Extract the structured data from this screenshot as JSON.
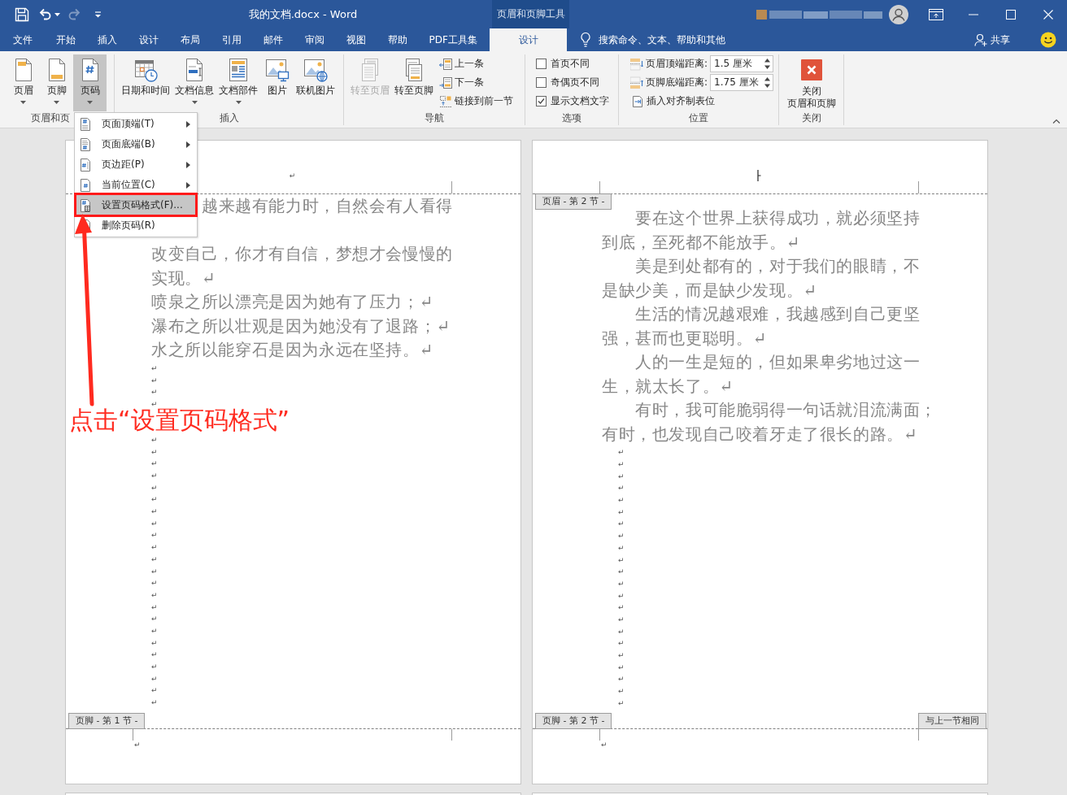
{
  "window": {
    "title": "我的文档.docx - Word",
    "contextual_tab_group": "页眉和页脚工具"
  },
  "quick_access": [
    {
      "kind": "save",
      "disabled": false,
      "dropdown": false
    },
    {
      "kind": "undo",
      "disabled": false,
      "dropdown": true
    },
    {
      "kind": "redo",
      "disabled": true,
      "dropdown": false
    },
    {
      "kind": "customize",
      "disabled": false,
      "dropdown": false
    }
  ],
  "tabs": [
    {
      "label": "文件",
      "selected": false
    },
    {
      "label": "开始",
      "selected": false
    },
    {
      "label": "插入",
      "selected": false
    },
    {
      "label": "设计",
      "selected": false
    },
    {
      "label": "布局",
      "selected": false
    },
    {
      "label": "引用",
      "selected": false
    },
    {
      "label": "邮件",
      "selected": false
    },
    {
      "label": "审阅",
      "selected": false
    },
    {
      "label": "视图",
      "selected": false
    },
    {
      "label": "帮助",
      "selected": false
    },
    {
      "label": "PDF工具集",
      "selected": false
    },
    {
      "label": "设计",
      "selected": true
    }
  ],
  "search": {
    "placeholder": "搜索命令、文本、帮助和其他"
  },
  "share": {
    "label": "共享"
  },
  "ribbon": {
    "groups": [
      {
        "label": "页眉和页",
        "items": [
          {
            "kind": "large",
            "label": "页眉",
            "dropdown": true,
            "pressed": false,
            "disabled": false
          },
          {
            "kind": "large",
            "label": "页脚",
            "dropdown": true,
            "pressed": false,
            "disabled": false
          },
          {
            "kind": "large",
            "label": "页码",
            "dropdown": true,
            "pressed": true,
            "disabled": false
          }
        ]
      },
      {
        "label": "插入",
        "items": [
          {
            "kind": "large",
            "label": "日期和时间",
            "dropdown": false,
            "pressed": false,
            "disabled": false
          },
          {
            "kind": "large",
            "label": "文档信息",
            "dropdown": true,
            "pressed": false,
            "disabled": false
          },
          {
            "kind": "large",
            "label": "文档部件",
            "dropdown": true,
            "pressed": false,
            "disabled": false
          },
          {
            "kind": "large",
            "label": "图片",
            "dropdown": false,
            "pressed": false,
            "disabled": false
          },
          {
            "kind": "large",
            "label": "联机图片",
            "dropdown": false,
            "pressed": false,
            "disabled": false
          }
        ]
      },
      {
        "label": "导航",
        "items": [
          {
            "kind": "large",
            "label": "转至页眉",
            "dropdown": false,
            "pressed": false,
            "disabled": true
          },
          {
            "kind": "large",
            "label": "转至页脚",
            "dropdown": false,
            "pressed": false,
            "disabled": false
          },
          {
            "kind": "small",
            "label": "上一条",
            "disabled": false
          },
          {
            "kind": "small",
            "label": "下一条",
            "disabled": false
          },
          {
            "kind": "small",
            "label": "链接到前一节",
            "disabled": false
          }
        ]
      },
      {
        "label": "选项",
        "items": [
          {
            "kind": "checkbox",
            "label": "首页不同",
            "checked": false
          },
          {
            "kind": "checkbox",
            "label": "奇偶页不同",
            "checked": false
          },
          {
            "kind": "checkbox",
            "label": "显示文档文字",
            "checked": true
          }
        ]
      },
      {
        "label": "位置",
        "items": [
          {
            "kind": "spinner",
            "label": "页眉顶端距离:",
            "value": "1.5 厘米"
          },
          {
            "kind": "spinner",
            "label": "页脚底端距离:",
            "value": "1.75 厘米"
          },
          {
            "kind": "small",
            "label": "插入对齐制表位",
            "disabled": false
          }
        ]
      },
      {
        "label": "关闭",
        "items": [
          {
            "kind": "close",
            "label_lines": [
              "关闭",
              "页眉和页脚"
            ]
          }
        ]
      }
    ]
  },
  "page_number_menu": {
    "items": [
      {
        "label": "页面顶端(T)",
        "submenu": true,
        "selected": false
      },
      {
        "label": "页面底端(B)",
        "submenu": true,
        "selected": false
      },
      {
        "label": "页边距(P)",
        "submenu": true,
        "selected": false
      },
      {
        "label": "当前位置(C)",
        "submenu": true,
        "selected": false
      },
      {
        "label": "设置页码格式(F)...",
        "submenu": false,
        "selected": true
      },
      {
        "label": "删除页码(R)",
        "submenu": false,
        "selected": false
      }
    ]
  },
  "pages": [
    {
      "header": {
        "cursor": false,
        "mark": "↵"
      },
      "paragraphs": [
        {
          "lines": [
            "越来越有能力时，自然会有人看得"
          ],
          "indent": false,
          "covered": true
        },
        {
          "lines": [
            "改变自己，你才有自信，梦想才会慢慢的",
            "实现。↵"
          ],
          "indent": false,
          "covered": false
        },
        {
          "lines": [
            "喷泉之所以漂亮是因为她有了压力；↵"
          ],
          "indent": false,
          "covered": false
        },
        {
          "lines": [
            "瀑布之所以壮观是因为她没有了退路；↵"
          ],
          "indent": false,
          "covered": false
        },
        {
          "lines": [
            "水之所以能穿石是因为永远在坚持。↵"
          ],
          "indent": false,
          "covered": false
        }
      ],
      "empty_paragraph_runs": [
        [
          "↵",
          "↵",
          "↵",
          "↵"
        ],
        [
          "↵",
          "↵",
          "↵",
          "↵",
          "↵",
          "↵",
          "↵",
          "↵",
          "↵",
          "↵",
          "↵",
          "↵",
          "↵",
          "↵",
          "↵",
          "↵",
          "↵",
          "↵",
          "↵",
          "↵",
          "↵",
          "↵",
          "↵"
        ]
      ],
      "footer_tabs": [
        {
          "label": "页脚 - 第 1 节 -",
          "kind": "section"
        }
      ],
      "footer_mark": "↵"
    },
    {
      "header": {
        "cursor": true
      },
      "header_tabs": [
        {
          "label": "页眉 - 第 2 节 -",
          "kind": "section"
        }
      ],
      "paragraphs": [
        {
          "lines": [
            "要在这个世界上获得成功，就必须坚持",
            "到底，至死都不能放手。↵"
          ],
          "indent": true,
          "covered": false
        },
        {
          "lines": [
            "美是到处都有的，对于我们的眼睛，不",
            "是缺少美，而是缺少发现。↵"
          ],
          "indent": true,
          "covered": false
        },
        {
          "lines": [
            "生活的情况越艰难，我越感到自己更坚",
            "强，甚而也更聪明。↵"
          ],
          "indent": true,
          "covered": false
        },
        {
          "lines": [
            "人的一生是短的，但如果卑劣地过这一",
            "生，就太长了。↵"
          ],
          "indent": true,
          "covered": false
        },
        {
          "lines": [
            "有时，我可能脆弱得一句话就泪流满面；",
            "有时，也发现自己咬着牙走了很长的路。↵"
          ],
          "indent": true,
          "covered": false
        }
      ],
      "empty_paragraph_runs": [
        [
          "↵",
          "↵",
          "↵",
          "↵",
          "↵",
          "↵",
          "↵",
          "↵",
          "↵",
          "↵",
          "↵",
          "↵",
          "↵",
          "↵",
          "↵",
          "↵",
          "↵",
          "↵",
          "↵",
          "↵",
          "↵",
          "↵"
        ]
      ],
      "footer_tabs": [
        {
          "label": "页脚 - 第 2 节 -",
          "kind": "section"
        },
        {
          "label": "与上一节相同",
          "kind": "link"
        }
      ],
      "footer_mark": "↵"
    }
  ],
  "annotation": {
    "text": "点击“设置页码格式”"
  }
}
